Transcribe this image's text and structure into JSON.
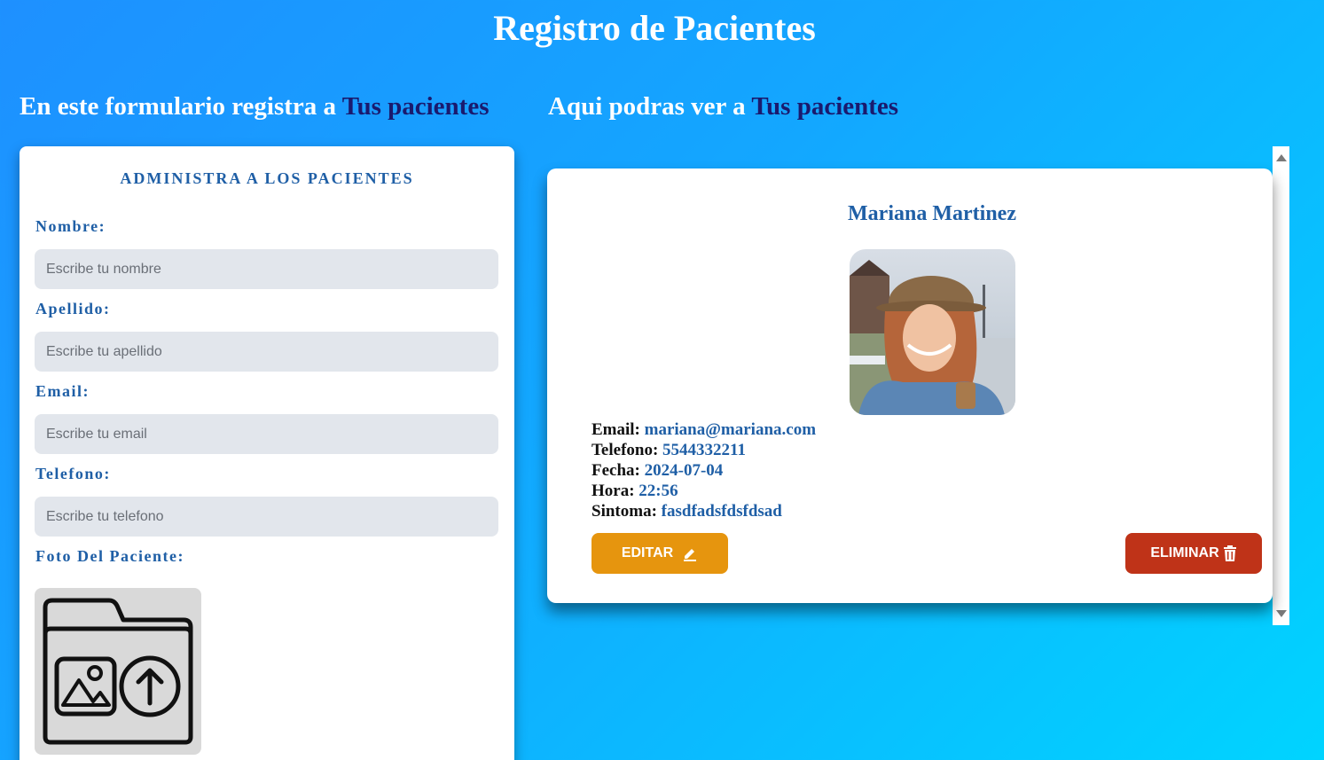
{
  "header": {
    "title": "Registro de Pacientes"
  },
  "form_section": {
    "heading_prefix": "En este formulario registra a ",
    "heading_highlight": "Tus pacientes",
    "card_title": "ADMINISTRA A LOS PACIENTES",
    "fields": [
      {
        "label": "Nombre:",
        "placeholder": "Escribe tu nombre",
        "value": ""
      },
      {
        "label": "Apellido:",
        "placeholder": "Escribe tu apellido",
        "value": ""
      },
      {
        "label": "Email:",
        "placeholder": "Escribe tu email",
        "value": ""
      },
      {
        "label": "Telefono:",
        "placeholder": "Escribe tu telefono",
        "value": ""
      }
    ],
    "photo_label": "Foto Del Paciente:",
    "upload_icon": "folder-upload-icon"
  },
  "list_section": {
    "heading_prefix": "Aqui podras ver a ",
    "heading_highlight": "Tus pacientes",
    "patients": [
      {
        "name": "Mariana Martinez",
        "email_label": "Email:",
        "email": "mariana@mariana.com",
        "phone_label": "Telefono:",
        "phone": "5544332211",
        "date_label": "Fecha:",
        "date": "2024-07-04",
        "time_label": "Hora:",
        "time": "22:56",
        "symptom_label": "Sintoma:",
        "symptom": "fasdfadsfdsfdsad",
        "edit_label": "EDITAR",
        "delete_label": "ELIMINAR"
      }
    ]
  },
  "colors": {
    "accent_blue": "#1f5fa6",
    "highlight_navy": "#1a1a6e",
    "edit_button": "#e6950e",
    "delete_button": "#bf3318"
  }
}
